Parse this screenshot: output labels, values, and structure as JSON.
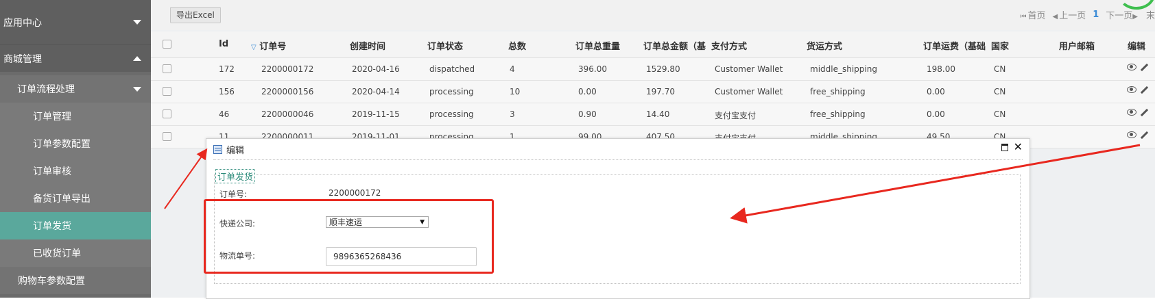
{
  "sidebar": {
    "items": [
      {
        "label": "应用中心"
      },
      {
        "label": "商城管理"
      },
      {
        "label": "订单流程处理"
      },
      {
        "label": "订单管理"
      },
      {
        "label": "订单参数配置"
      },
      {
        "label": "订单审核"
      },
      {
        "label": "备货订单导出"
      },
      {
        "label": "订单发货"
      },
      {
        "label": "已收货订单"
      },
      {
        "label": "购物车参数配置"
      }
    ]
  },
  "toolbar": {
    "export_label": "导出Excel"
  },
  "pager": {
    "first": "首页",
    "prev": "上一页",
    "current": "1",
    "next": "下一页",
    "last": "末"
  },
  "table": {
    "headers": [
      "Id",
      "订单号",
      "创建时间",
      "订单状态",
      "总数",
      "订单总重量",
      "订单总金额（基",
      "支付方式",
      "货运方式",
      "订单运费（基础",
      "国家",
      "用户邮箱",
      "编辑"
    ],
    "rows": [
      [
        "172",
        "2200000172",
        "2020-04-16",
        "dispatched",
        "4",
        "396.00",
        "1529.80",
        "Customer Wallet",
        "middle_shipping",
        "198.00",
        "CN"
      ],
      [
        "156",
        "2200000156",
        "2020-04-14",
        "processing",
        "10",
        "0.00",
        "197.70",
        "Customer Wallet",
        "free_shipping",
        "0.00",
        "CN"
      ],
      [
        "46",
        "2200000046",
        "2019-11-15",
        "processing",
        "3",
        "0.90",
        "14.40",
        "支付宝支付",
        "free_shipping",
        "0.00",
        "CN"
      ],
      [
        "11",
        "2200000011",
        "2019-11-01",
        "processing",
        "1",
        "99.00",
        "407.50",
        "支付宝支付",
        "middle_shipping",
        "49.50",
        "CN"
      ]
    ]
  },
  "dialog": {
    "title": "编辑",
    "legend": "订单发货",
    "order_no_label": "订单号:",
    "order_no_value": "2200000172",
    "courier_label": "快递公司:",
    "courier_value": "顺丰速运",
    "tracking_label": "物流单号:",
    "tracking_value": "9896365268436"
  },
  "colors": {
    "accent": "#5aa89c",
    "annotation": "#e8281f"
  }
}
